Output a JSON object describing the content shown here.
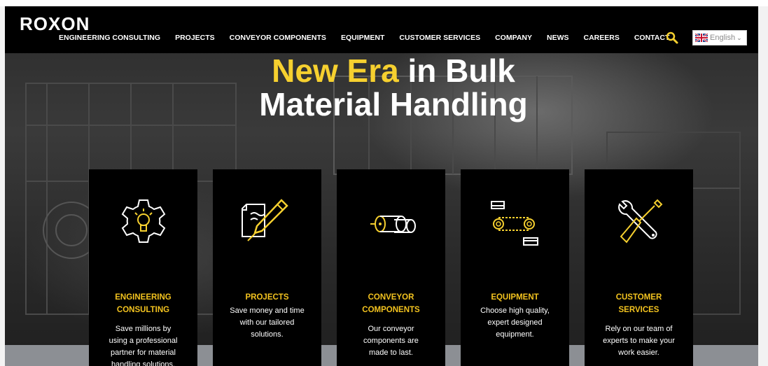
{
  "nav": {
    "logo": "ROXON",
    "items": [
      "ENGINEERING CONSULTING",
      "PROJECTS",
      "CONVEYOR COMPONENTS",
      "EQUIPMENT",
      "CUSTOMER SERVICES",
      "COMPANY",
      "NEWS",
      "CAREERS",
      "CONTACT"
    ],
    "search_icon": "search-icon",
    "language": "English"
  },
  "hero": {
    "headline_highlight": "New Era",
    "headline_rest_line1": " in Bulk",
    "headline_line2": "Material Handling"
  },
  "cards": [
    {
      "title_line1": "ENGINEERING",
      "title_line2": "CONSULTING",
      "desc": [
        "Save millions by",
        "using a professional",
        "partner for material",
        "handling solutions."
      ],
      "icon": "lightbulb-gear-icon"
    },
    {
      "title_line1": "PROJECTS",
      "title_line2": "",
      "desc": [
        "Save money and time",
        "with our tailored",
        "solutions."
      ],
      "icon": "document-pen-icon"
    },
    {
      "title_line1": "CONVEYOR",
      "title_line2": "COMPONENTS",
      "desc": [
        "Our conveyor",
        "components are",
        "made to last."
      ],
      "icon": "conveyor-roller-icon"
    },
    {
      "title_line1": "EQUIPMENT",
      "title_line2": "",
      "desc": [
        "Choose high quality,",
        "expert designed",
        "equipment."
      ],
      "icon": "conveyor-belt-icon"
    },
    {
      "title_line1": "CUSTOMER",
      "title_line2": "SERVICES",
      "desc": [
        "Rely on our team of",
        "experts to make your",
        "work easier."
      ],
      "icon": "wrench-screwdriver-icon"
    }
  ],
  "colors": {
    "accent": "#f6d02f",
    "nav_bg": "#000000",
    "card_bg": "#000000"
  }
}
